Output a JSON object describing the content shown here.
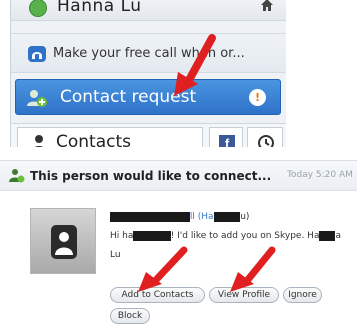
{
  "sidebar": {
    "profile_name": "Hanna Lu",
    "promo_text": "Make your free call when or...",
    "contact_request": {
      "label": "Contact request",
      "badge": "!"
    },
    "tabs": {
      "contacts_label": "Contacts",
      "facebook_glyph": "f"
    }
  },
  "request": {
    "title": "This person would like to connect...",
    "time": "Today 5:20 AM",
    "name_visible": "ll (Ha",
    "name_end": "u)",
    "message_start": "Hi ha",
    "message_mid": "! I'd like to add you on Skype. Ha",
    "message_tail": "a",
    "message_end": "Lu",
    "buttons": {
      "add": "Add to Contacts",
      "view": "View Profile",
      "ignore": "Ignore",
      "block": "Block"
    }
  },
  "colors": {
    "accent": "#2f73c9",
    "arrow": "#e02020"
  },
  "icons": [
    "status-icon",
    "home-icon",
    "skype-icon",
    "add-contact-icon",
    "person-icon",
    "facebook-icon",
    "clock-icon"
  ]
}
